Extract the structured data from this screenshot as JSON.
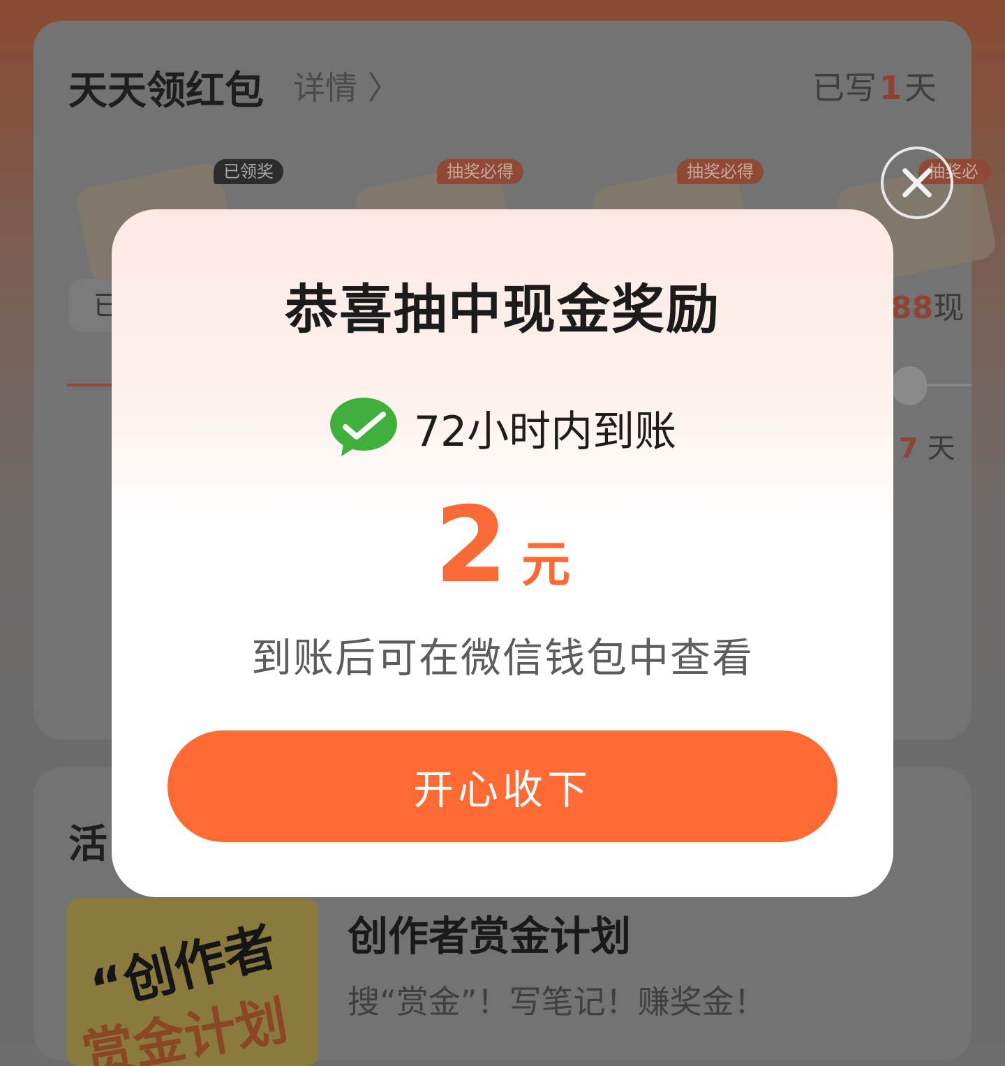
{
  "background": {
    "card1": {
      "title": "天天领红包",
      "detail_link": "详情 〉",
      "written_prefix": "已写",
      "written_days": "1",
      "written_suffix": "天",
      "tags": [
        "已领奖",
        "抽奖必得",
        "抽奖必得",
        "抽奖必"
      ],
      "left_chip_text": "已",
      "right_prize_text": "88",
      "right_prize_suffix": "现",
      "right_day_num": "7",
      "right_day_suffix": "天"
    },
    "card2": {
      "heading": "活",
      "thumb_line1": "“创作者",
      "thumb_line2": "赏金计划",
      "item_title": "创作者赏金计划",
      "item_desc": "搜“赏金”！写笔记！赚奖金！"
    }
  },
  "modal": {
    "title": "恭喜抽中现金奖励",
    "arrival_text": "72小时内到账",
    "amount_value": "2",
    "amount_unit": "元",
    "hint": "到账后可在微信钱包中查看",
    "accept_label": "开心收下",
    "accent_color": "#ff6a34",
    "wechat_color": "#3fb03b"
  }
}
